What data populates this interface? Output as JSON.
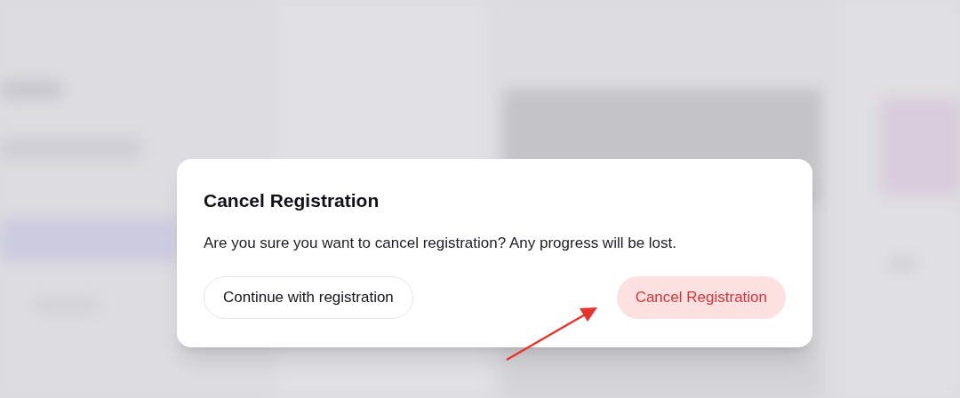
{
  "dialog": {
    "title": "Cancel Registration",
    "message": "Are you sure you want to cancel registration? Any progress will be lost.",
    "buttons": [
      {
        "label": "Continue with registration",
        "kind": "secondary"
      },
      {
        "label": "Cancel Registration",
        "kind": "destructive"
      }
    ]
  }
}
